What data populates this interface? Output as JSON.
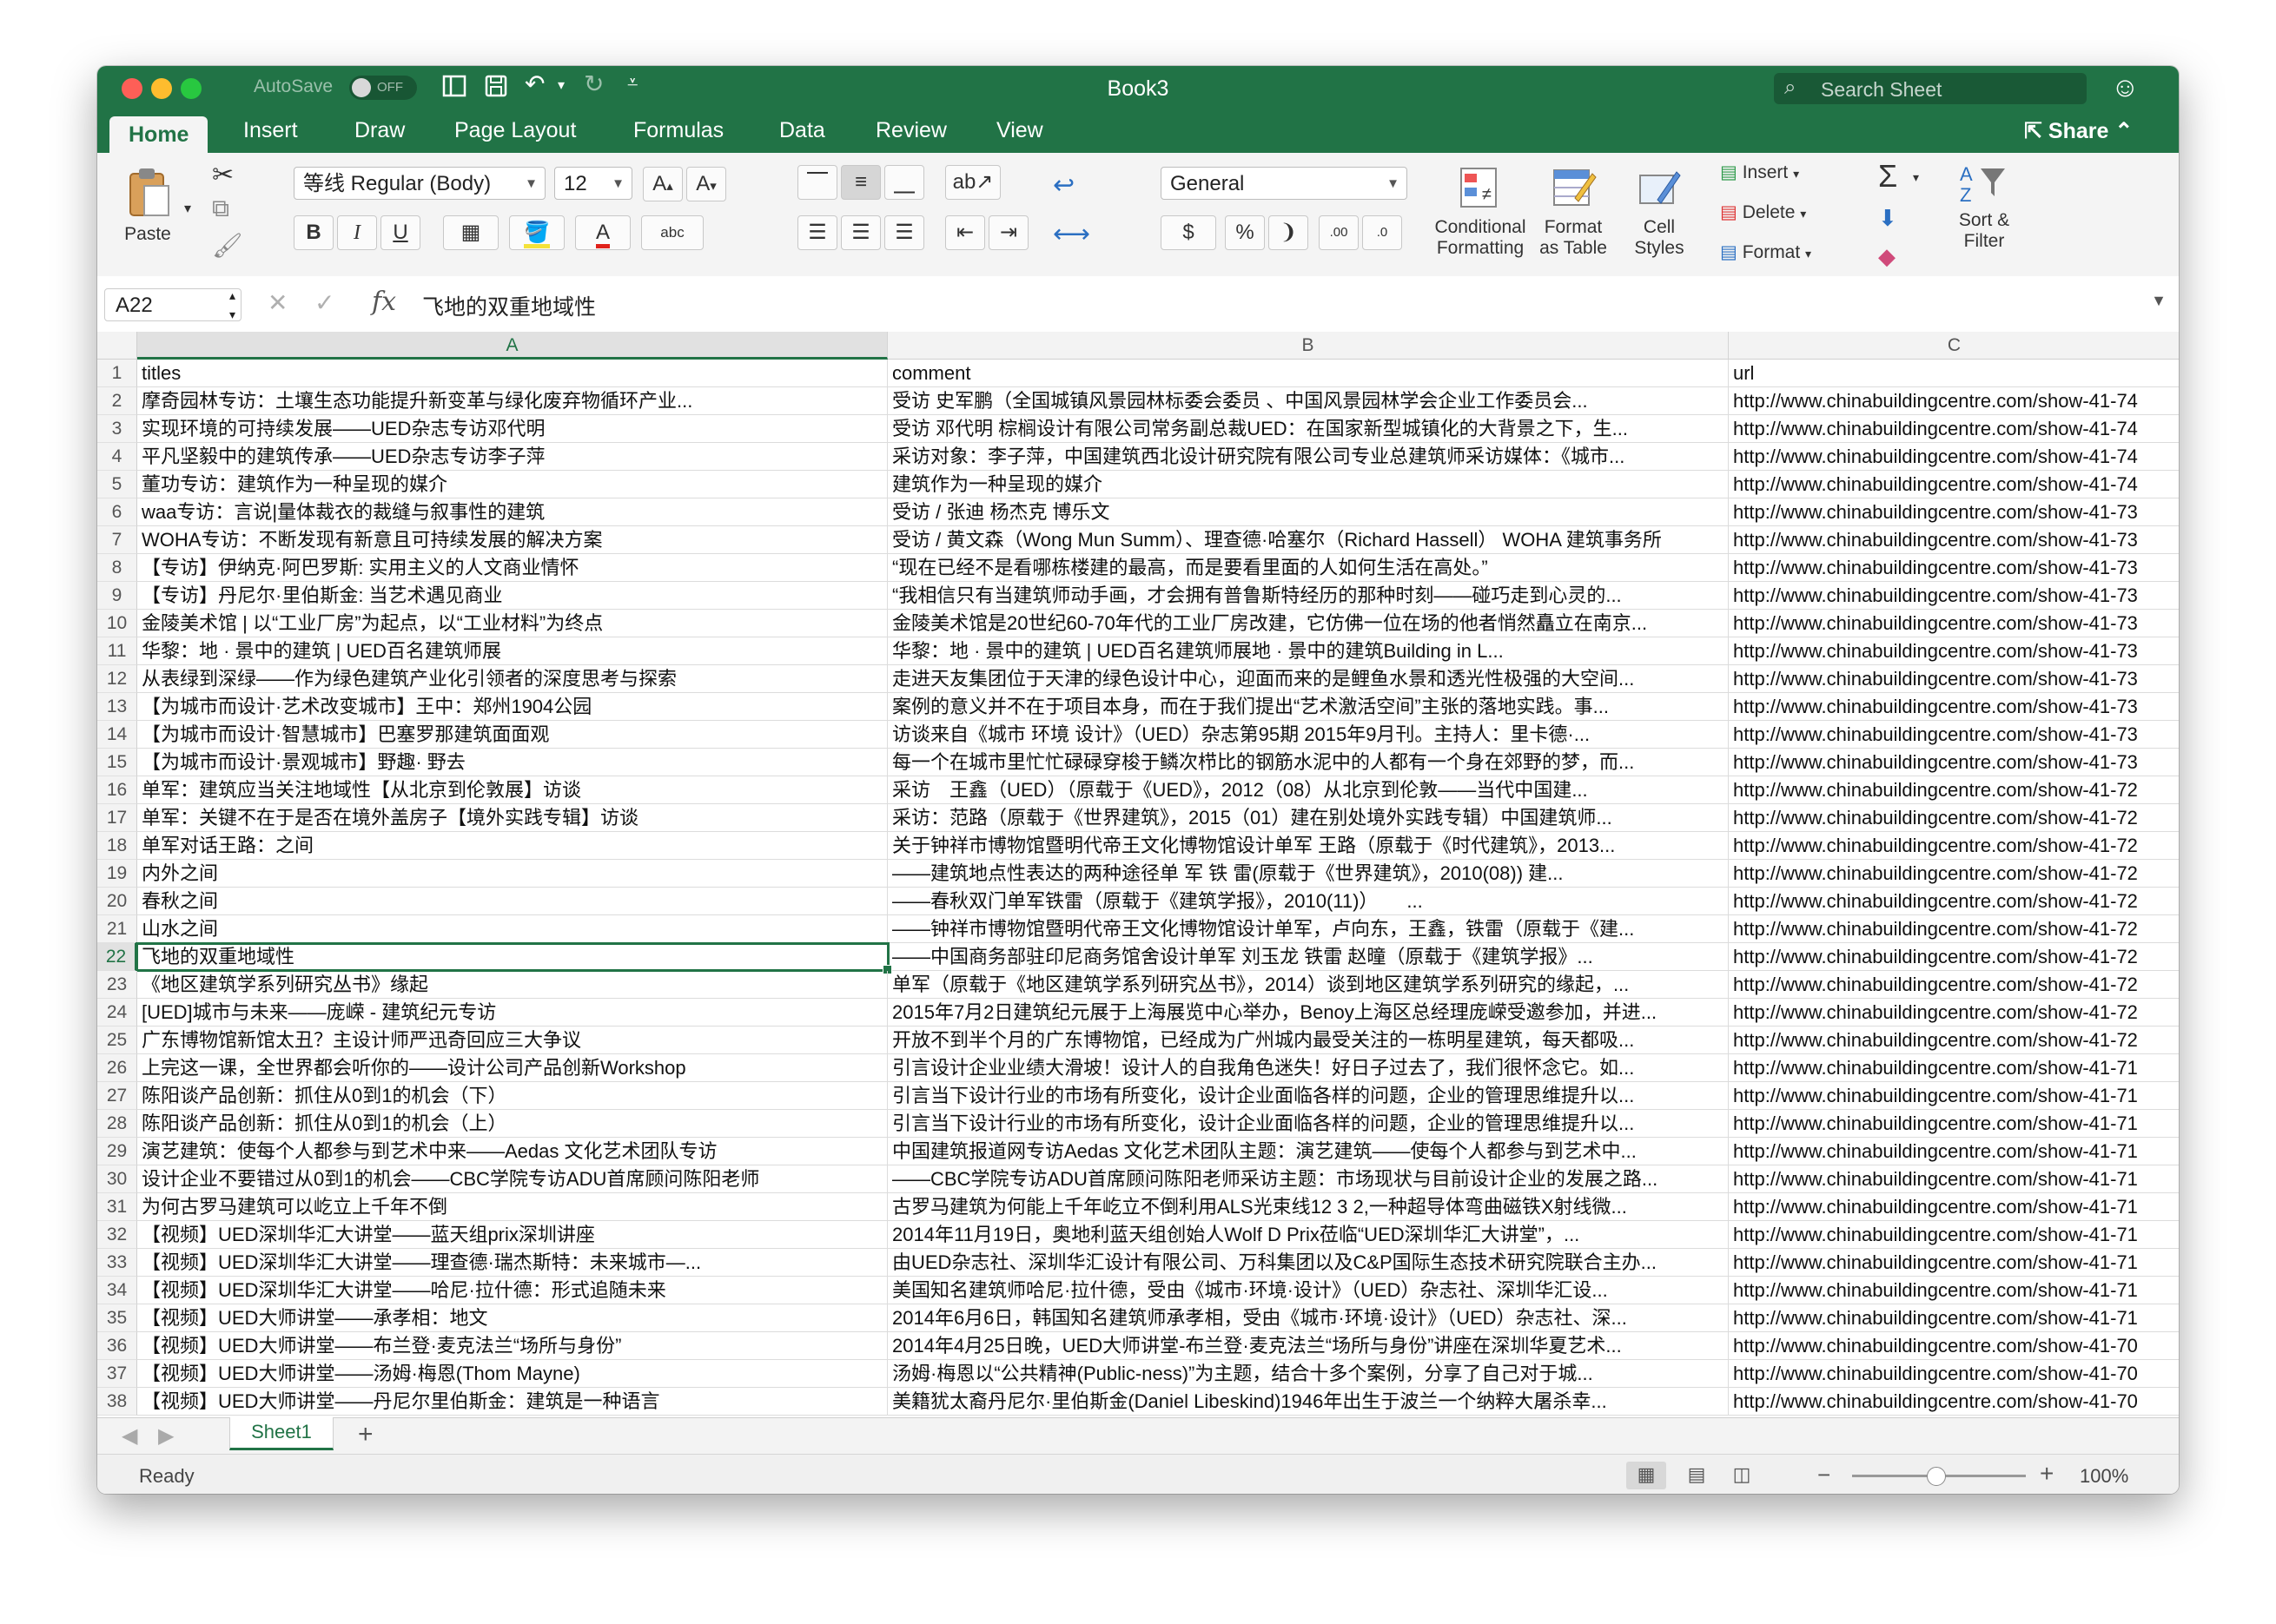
{
  "window": {
    "title": "Book3",
    "autosave_label": "AutoSave",
    "autosave_state": "OFF",
    "search_placeholder": "Search Sheet"
  },
  "ribbon": {
    "tabs": [
      "Home",
      "Insert",
      "Draw",
      "Page Layout",
      "Formulas",
      "Data",
      "Review",
      "View"
    ],
    "active_tab": "Home",
    "share_label": "Share",
    "paste_label": "Paste",
    "font_name": "等线 Regular (Body)",
    "font_size": "12",
    "number_format": "General",
    "conditional_formatting": [
      "Conditional",
      "Formatting"
    ],
    "format_as_table": [
      "Format",
      "as Table"
    ],
    "cell_styles": [
      "Cell",
      "Styles"
    ],
    "insert_label": "Insert",
    "delete_label": "Delete",
    "format_label": "Format",
    "sort_filter": [
      "Sort &",
      "Filter"
    ],
    "wrap_label": "abc"
  },
  "formula_bar": {
    "name_box": "A22",
    "fx_label": "fx",
    "content": "飞地的双重地域性"
  },
  "grid": {
    "columns": [
      "A",
      "B",
      "C"
    ],
    "active_cell": "A22",
    "rows": [
      {
        "n": "1",
        "a": "titles",
        "b": "comment",
        "c": "url"
      },
      {
        "n": "2",
        "a": "摩奇园林专访：土壤生态功能提升新变革与绿化废弃物循环产业...",
        "b": "受访 史军鹏（全国城镇风景园林标委会委员 、中国风景园林学会企业工作委员会...",
        "c": "http://www.chinabuildingcentre.com/show-41-74"
      },
      {
        "n": "3",
        "a": "实现环境的可持续发展——UED杂志专访邓代明",
        "b": "受访 邓代明 棕榈设计有限公司常务副总裁UED：在国家新型城镇化的大背景之下，生...",
        "c": "http://www.chinabuildingcentre.com/show-41-74"
      },
      {
        "n": "4",
        "a": "平凡坚毅中的建筑传承——UED杂志专访李子萍",
        "b": "采访对象：李子萍，中国建筑西北设计研究院有限公司专业总建筑师采访媒体：《城市...",
        "c": "http://www.chinabuildingcentre.com/show-41-74"
      },
      {
        "n": "5",
        "a": "董功专访：建筑作为一种呈现的媒介",
        "b": "建筑作为一种呈现的媒介",
        "c": "http://www.chinabuildingcentre.com/show-41-74"
      },
      {
        "n": "6",
        "a": "waa专访：言说|量体裁衣的裁缝与叙事性的建筑",
        "b": "受访 / 张迪 杨杰克 博乐文",
        "c": "http://www.chinabuildingcentre.com/show-41-73"
      },
      {
        "n": "7",
        "a": "WOHA专访：不断发现有新意且可持续发展的解决方案",
        "b": "受访 / 黄文森（Wong Mun Summ）、理查德·哈塞尔（Richard Hassell） WOHA 建筑事务所",
        "c": "http://www.chinabuildingcentre.com/show-41-73"
      },
      {
        "n": "8",
        "a": "【专访】伊纳克·阿巴罗斯: 实用主义的人文商业情怀",
        "b": "“现在已经不是看哪栋楼建的最高，而是要看里面的人如何生活在高处。”",
        "c": "http://www.chinabuildingcentre.com/show-41-73"
      },
      {
        "n": "9",
        "a": "【专访】丹尼尔·里伯斯金: 当艺术遇见商业",
        "b": "“我相信只有当建筑师动手画，才会拥有普鲁斯特经历的那种时刻——碰巧走到心灵的...",
        "c": "http://www.chinabuildingcentre.com/show-41-73"
      },
      {
        "n": "10",
        "a": "金陵美术馆 | 以“工业厂房”为起点，以“工业材料”为终点",
        "b": "金陵美术馆是20世纪60-70年代的工业厂房改建，它仿佛一位在场的他者悄然矗立在南京...",
        "c": "http://www.chinabuildingcentre.com/show-41-73"
      },
      {
        "n": "11",
        "a": "华黎：地 · 景中的建筑 | UED百名建筑师展",
        "b": "华黎：地 · 景中的建筑 | UED百名建筑师展地 · 景中的建筑Building in L...",
        "c": "http://www.chinabuildingcentre.com/show-41-73"
      },
      {
        "n": "12",
        "a": "从表绿到深绿——作为绿色建筑产业化引领者的深度思考与探索",
        "b": "走进天友集团位于天津的绿色设计中心，迎面而来的是鲤鱼水景和透光性极强的大空间...",
        "c": "http://www.chinabuildingcentre.com/show-41-73"
      },
      {
        "n": "13",
        "a": "【为城市而设计·艺术改变城市】王中：郑州1904公园",
        "b": "案例的意义并不在于项目本身，而在于我们提出“艺术激活空间”主张的落地实践。事...",
        "c": "http://www.chinabuildingcentre.com/show-41-73"
      },
      {
        "n": "14",
        "a": "【为城市而设计·智慧城市】巴塞罗那建筑面面观",
        "b": "访谈来自《城市 环境 设计》（UED）杂志第95期 2015年9月刊。主持人：里卡德·...",
        "c": "http://www.chinabuildingcentre.com/show-41-73"
      },
      {
        "n": "15",
        "a": "【为城市而设计·景观城市】野趣· 野去",
        "b": "每一个在城市里忙忙碌碌穿梭于鳞次栉比的钢筋水泥中的人都有一个身在郊野的梦，而...",
        "c": "http://www.chinabuildingcentre.com/show-41-73"
      },
      {
        "n": "16",
        "a": "单军：建筑应当关注地域性【从北京到伦敦展】访谈",
        "b": "采访　王鑫（UED）（原载于《UED》，2012（08）从北京到伦敦——当代中国建...",
        "c": "http://www.chinabuildingcentre.com/show-41-72"
      },
      {
        "n": "17",
        "a": "单军：关键不在于是否在境外盖房子【境外实践专辑】访谈",
        "b": "采访：范路（原载于《世界建筑》，2015（01）建在别处境外实践专辑）中国建筑师...",
        "c": "http://www.chinabuildingcentre.com/show-41-72"
      },
      {
        "n": "18",
        "a": "单军对话王路：之间",
        "b": "关于钟祥市博物馆暨明代帝王文化博物馆设计单军 王路（原载于《时代建筑》，2013...",
        "c": "http://www.chinabuildingcentre.com/show-41-72"
      },
      {
        "n": "19",
        "a": "内外之间",
        "b": "——建筑地点性表达的两种途径单 军 铁 雷(原载于《世界建筑》，2010(08)) 建...",
        "c": "http://www.chinabuildingcentre.com/show-41-72"
      },
      {
        "n": "20",
        "a": "春秋之间",
        "b": "——春秋双门单军铁雷（原载于《建筑学报》，2010(11)）　　...",
        "c": "http://www.chinabuildingcentre.com/show-41-72"
      },
      {
        "n": "21",
        "a": "山水之间",
        "b": "——钟祥市博物馆暨明代帝王文化博物馆设计单军，卢向东，王鑫，铁雷（原载于《建...",
        "c": "http://www.chinabuildingcentre.com/show-41-72"
      },
      {
        "n": "22",
        "a": "飞地的双重地域性",
        "b": "——中国商务部驻印尼商务馆舍设计单军 刘玉龙 铁雷 赵曈（原载于《建筑学报》...",
        "c": "http://www.chinabuildingcentre.com/show-41-72"
      },
      {
        "n": "23",
        "a": "《地区建筑学系列研究丛书》缘起",
        "b": "单军（原载于《地区建筑学系列研究丛书》，2014）谈到地区建筑学系列研究的缘起，...",
        "c": "http://www.chinabuildingcentre.com/show-41-72"
      },
      {
        "n": "24",
        "a": "[UED]城市与未来——庞嵘 - 建筑纪元专访",
        "b": "2015年7月2日建筑纪元展于上海展览中心举办，Benoy上海区总经理庞嵘受邀参加，并进...",
        "c": "http://www.chinabuildingcentre.com/show-41-72"
      },
      {
        "n": "25",
        "a": "广东博物馆新馆太丑？主设计师严迅奇回应三大争议",
        "b": "开放不到半个月的广东博物馆，已经成为广州城内最受关注的一栋明星建筑，每天都吸...",
        "c": "http://www.chinabuildingcentre.com/show-41-72"
      },
      {
        "n": "26",
        "a": "上完这一课，全世界都会听你的——设计公司产品创新Workshop",
        "b": "引言设计企业业绩大滑坡！设计人的自我角色迷失！好日子过去了，我们很怀念它。如...",
        "c": "http://www.chinabuildingcentre.com/show-41-71"
      },
      {
        "n": "27",
        "a": "陈阳谈产品创新：抓住从0到1的机会（下）",
        "b": "引言当下设计行业的市场有所变化，设计企业面临各样的问题，企业的管理思维提升以...",
        "c": "http://www.chinabuildingcentre.com/show-41-71"
      },
      {
        "n": "28",
        "a": "陈阳谈产品创新：抓住从0到1的机会（上）",
        "b": "引言当下设计行业的市场有所变化，设计企业面临各样的问题，企业的管理思维提升以...",
        "c": "http://www.chinabuildingcentre.com/show-41-71"
      },
      {
        "n": "29",
        "a": "演艺建筑：使每个人都参与到艺术中来——Aedas 文化艺术团队专访",
        "b": "中国建筑报道网专访Aedas 文化艺术团队主题：演艺建筑——使每个人都参与到艺术中...",
        "c": "http://www.chinabuildingcentre.com/show-41-71"
      },
      {
        "n": "30",
        "a": "设计企业不要错过从0到1的机会——CBC学院专访ADU首席顾问陈阳老师",
        "b": "——CBC学院专访ADU首席顾问陈阳老师采访主题：市场现状与目前设计企业的发展之路...",
        "c": "http://www.chinabuildingcentre.com/show-41-71"
      },
      {
        "n": "31",
        "a": "为何古罗马建筑可以屹立上千年不倒",
        "b": "古罗马建筑为何能上千年屹立不倒利用ALS光束线12 3 2,一种超导体弯曲磁铁X射线微...",
        "c": "http://www.chinabuildingcentre.com/show-41-71"
      },
      {
        "n": "32",
        "a": "【视频】UED深圳华汇大讲堂——蓝天组prix深圳讲座",
        "b": "2014年11月19日，奥地利蓝天组创始人Wolf D  Prix莅临“UED深圳华汇大讲堂”，...",
        "c": "http://www.chinabuildingcentre.com/show-41-71"
      },
      {
        "n": "33",
        "a": "【视频】UED深圳华汇大讲堂——理查德·瑞杰斯特：未来城市—...",
        "b": "由UED杂志社、深圳华汇设计有限公司、万科集团以及C&P国际生态技术研究院联合主办...",
        "c": "http://www.chinabuildingcentre.com/show-41-71"
      },
      {
        "n": "34",
        "a": "【视频】UED深圳华汇大讲堂——哈尼·拉什德：形式追随未来",
        "b": "美国知名建筑师哈尼·拉什德，受由《城市·环境·设计》（UED）杂志社、深圳华汇设...",
        "c": "http://www.chinabuildingcentre.com/show-41-71"
      },
      {
        "n": "35",
        "a": "【视频】UED大师讲堂——承孝相：地文",
        "b": "2014年6月6日，韩国知名建筑师承孝相，受由《城市·环境·设计》（UED）杂志社、深...",
        "c": "http://www.chinabuildingcentre.com/show-41-71"
      },
      {
        "n": "36",
        "a": "【视频】UED大师讲堂——布兰登·麦克法兰“场所与身份”",
        "b": "2014年4月25日晚，UED大师讲堂-布兰登·麦克法兰“场所与身份”讲座在深圳华夏艺术...",
        "c": "http://www.chinabuildingcentre.com/show-41-70"
      },
      {
        "n": "37",
        "a": "【视频】UED大师讲堂——汤姆·梅恩(Thom Mayne)",
        "b": "汤姆·梅恩以“公共精神(Public-ness)”为主题，结合十多个案例，分享了自己对于城...",
        "c": "http://www.chinabuildingcentre.com/show-41-70"
      },
      {
        "n": "38",
        "a": "【视频】UED大师讲堂——丹尼尔里伯斯金：建筑是一种语言",
        "b": "美籍犹太裔丹尼尔·里伯斯金(Daniel Libeskind)1946年出生于波兰一个纳粹大屠杀幸...",
        "c": "http://www.chinabuildingcentre.com/show-41-70"
      }
    ]
  },
  "sheets": {
    "tabs": [
      "Sheet1"
    ],
    "add_label": "+"
  },
  "status": {
    "text": "Ready",
    "zoom": "100%",
    "zoom_value": 100
  },
  "colors": {
    "accent": "#217346",
    "ribbon_bg": "#f4f4f4"
  }
}
